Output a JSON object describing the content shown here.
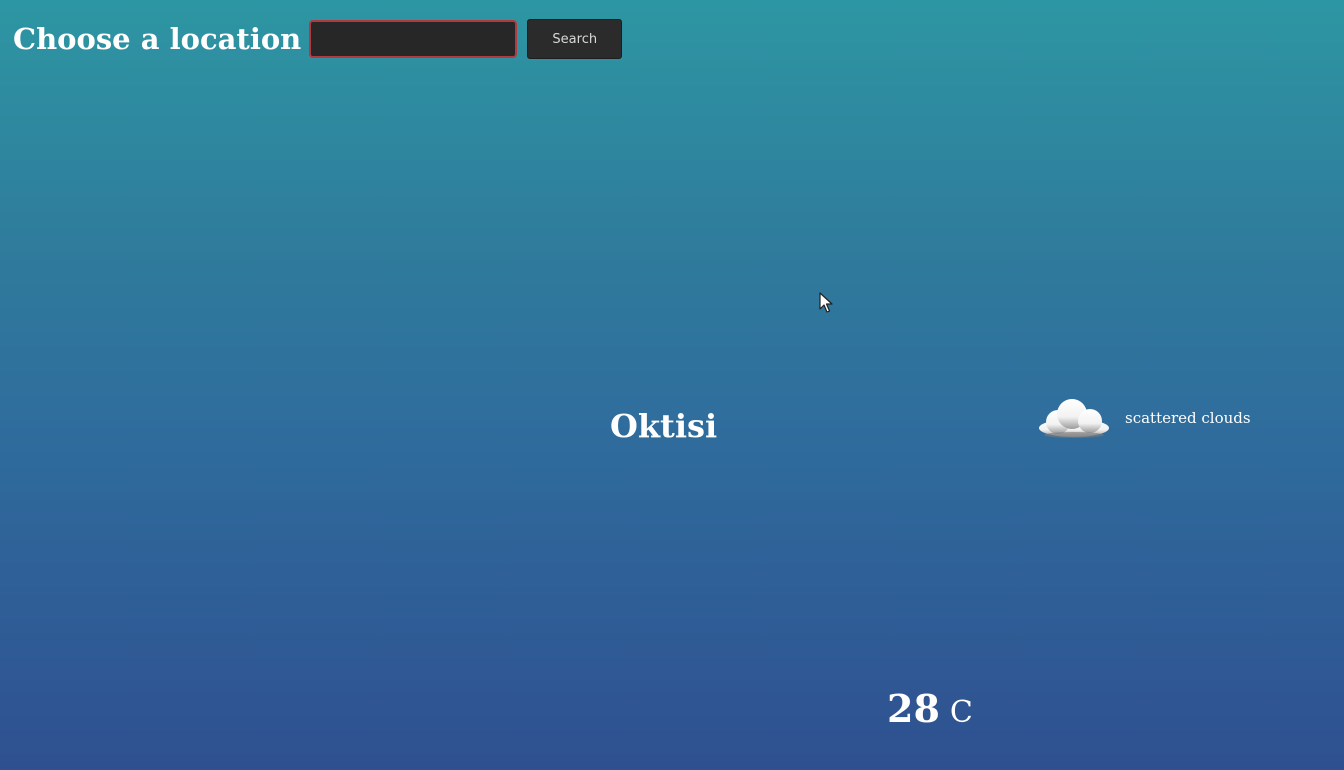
{
  "header": {
    "title": "Choose a location",
    "search_value": "",
    "search_placeholder": "",
    "search_button_label": "Search"
  },
  "weather": {
    "city": "Oktisi",
    "icon": "cloud-icon",
    "description": "scattered clouds",
    "temperature": "28",
    "unit": "C"
  },
  "colors": {
    "background_top": "#2d96a3",
    "background_bottom": "#2f5090",
    "input_background": "#272727",
    "input_border": "#b13a3e",
    "button_background": "#2b2b2b",
    "text": "#ffffff"
  }
}
